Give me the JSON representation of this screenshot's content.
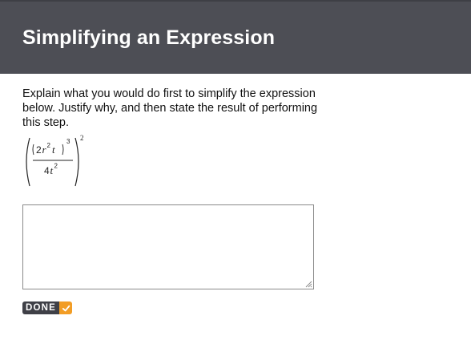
{
  "header": {
    "title": "Simplifying an Expression"
  },
  "prompt": {
    "text": "Explain what you would do first to simplify the expression below. Justify why, and then state the result of performing this step."
  },
  "expression": {
    "numerator_coefficient": "2",
    "numerator_var_r": "r",
    "r_exponent": "2",
    "numerator_var_t": "t",
    "inner_exponent": "3",
    "denominator_coefficient": "4",
    "denominator_var_t": "t",
    "denominator_exponent": "2",
    "outer_exponent": "2"
  },
  "answer": {
    "value": ""
  },
  "done_button": {
    "label": "DONE",
    "icon": "checkmark-icon",
    "label_bg": "#3f4047",
    "icon_bg": "#f29d25"
  },
  "colors": {
    "header_bg": "#4d4e55",
    "header_text": "#ffffff"
  }
}
